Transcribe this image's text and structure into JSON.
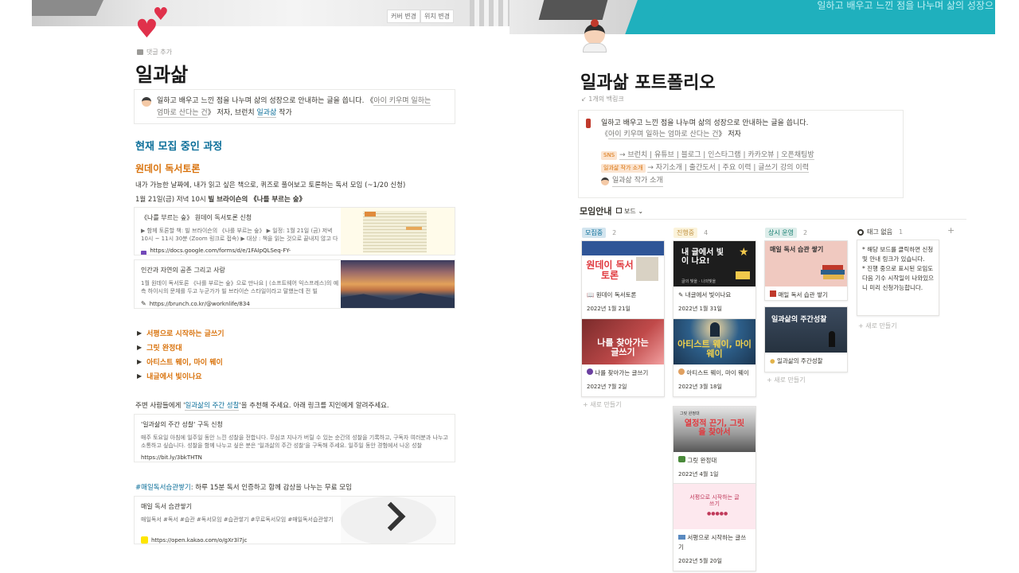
{
  "left": {
    "cover_buttons": [
      "커버 변경",
      "위치 변경"
    ],
    "add_comment": "댓글 추가",
    "title": "일과삶",
    "callout": {
      "line1": "일하고 배우고 느낀 점을 나누며 삶의 성장으로 안내하는 글을 씁니다. 《",
      "book_link": "아이 키우며 일하는",
      "line2_link": "엄마로 산다는 건",
      "line2_rest": "》 저자, 브런치 ",
      "brunch_link": "일과삶",
      "line2_end": " 작가"
    },
    "section_heading": "현재 모집 중인 과정",
    "oneday": {
      "heading": "원데이 독서토론",
      "desc": "내가 가능한 날짜에, 내가 읽고 싶은 책으로, 퀴즈로 풀어보고 토론하는 독서 모임 (~1/20 신청)",
      "date_line": "1월 21일(금) 저녁 10시 ",
      "date_bold": "빌 브라이슨의 《나를 부르는 숲》"
    },
    "bookmark1": {
      "title": "《나를 부르는 숲》 원데이 독서토론 신청",
      "desc": "▶ 함께 토론할 책: 빌 브라이슨의 《나를 부르는 숲》 ▶ 일정: 1월 21일 (금) 저녁 10시 ~ 11시 30분 (Zoom 링크로 접속) ▶ 대상 : 책을 읽는 것으로 끝내지 않고 다",
      "url": "https://docs.google.com/forms/d/e/1FAIpQLSeq-FY-38cwR4KwlHhDm43w..."
    },
    "bookmark2": {
      "title": "인간과 자연의 공존 그리고 사랑",
      "desc": "1월 원데이 독서토론 《나를 부르는 숲》으로 만나요 | (소프트웨어 익스프레스)의 예측 하이시의 문체를 두고 누군가가 빌 브라이슨 스타일이라고 말했는데 전 빌",
      "url": "https://brunch.co.kr/@worknlife/834"
    },
    "toggles": [
      "서평으로 시작하는 글쓰기",
      "그릿 완정대",
      "아티스트 웨이, 마이 웨이",
      "내글에서 빛이나요"
    ],
    "recommend": {
      "before": "주변 사람들에게 '",
      "link": "일과삶의 주간 성찰",
      "after": "'을 추천해 주세요. 아래 링크를 지인에게 알려주세요."
    },
    "bookmark3": {
      "title": "'일과삶의 주간 성찰' 구독 신청",
      "desc": "매주 토요일 아침에 일주일 동안 느낀 성찰을 전합니다. 무심코 지나가 버릴 수 있는 순간의 성찰을 기록하고, 구독자 여러분과 나누고 소통하고 싶습니다. 성찰을 함께 나누고 싶은 분은 '일과삶의 주간 성찰'을 구독해 주세요. 일주일 동안 경험에서 나온 성찰",
      "url": "https://bit.ly/3bkTHTN"
    },
    "reading": {
      "hashtag": "#매일독서습관쌓기",
      "text": ": 하루 15분 독서 인증하고 함께 감상을 나누는 무료 모임"
    },
    "bookmark4": {
      "title": "매일 독서 습관쌓기",
      "desc": "매일독서 #독서 #습관 #독서모임 #습관쌓기 #무료독서모임 #매일독서습관쌓기",
      "url": "https://open.kakao.com/o/gXr3l7jc"
    }
  },
  "right": {
    "cover_text": "일하고 배우고 느낀 점을 나누며 삶의 성장으",
    "title": "일과삶 포트폴리오",
    "backlinks": "1개의 백링크",
    "callout": {
      "line1": "일하고 배우고 느낀 점을 나누며 삶의 성장으로 안내하는 글을 씁니다.",
      "line2_open": "《",
      "line2_link": "아이 키우며 일하는 엄마로 산다는 건",
      "line2_close": "》 저자",
      "sns_tag": "SNS",
      "sns_links": "→ 브런치 | 유튜브 | 블로그 | 인스타그램 | 카카오뷰 | 오픈채팅방",
      "intro_tag": "일과삶 작가 소개",
      "intro_links": "→ 자기소개 | 출간도서 | 주요 이력 | 글쓰기 강의 이력",
      "author_link": "일과삶 작가 소개"
    },
    "section_title": "모임안내",
    "view_label": "보드",
    "columns": [
      {
        "label": "모집중",
        "count": "2",
        "bg": "#d3e5ef",
        "fg": "#0b6e99"
      },
      {
        "label": "진행중",
        "count": "4",
        "bg": "#fbf3db",
        "fg": "#dfab01"
      },
      {
        "label": "상시 운영",
        "count": "2",
        "bg": "#ddedea",
        "fg": "#0f7b6c"
      },
      {
        "label": "태그 없음",
        "count": "1",
        "bg": "transparent",
        "fg": "#37352f"
      }
    ],
    "cards": {
      "c1": {
        "thumb": "원데이 독서토론",
        "title": "원데이 독서토론",
        "date": "2022년 1월 21일"
      },
      "c2": {
        "thumb": "나를 찾아가는 글쓰기",
        "title": "나를 찾아가는 글쓰기",
        "date": "2022년 7월 2일"
      },
      "c3": {
        "thumb": "내 글에서 빛이 나요!",
        "thumb_sub": "글의 빛을 · 나의빛을",
        "title": "내글에서 빛이나요",
        "date": "2022년 1월 31일"
      },
      "c4": {
        "thumb": "아티스트 웨이, 마이 웨이",
        "title": "아티스트 웨이, 마이 웨이",
        "date": "2022년 3월 18일"
      },
      "c5": {
        "thumb": "열정적 끈기, 그릿을 찾아서",
        "thumb_top": "그릿 완정대",
        "title": "그릿 완정대",
        "date": "2022년 4월 1일"
      },
      "c6": {
        "thumb": "서평으로 시작하는 글쓰기",
        "title": "서평으로 시작하는 글쓰기",
        "date": "2022년 5월 20일"
      },
      "c7": {
        "thumb": "매일 독서 습관 쌓기",
        "title": "매일 독서 습관 쌓기"
      },
      "c8": {
        "thumb": "일과삶의 주간성찰",
        "title": "일과삶의 주간성찰"
      }
    },
    "new_label": "새로 만들기",
    "notag_note": "* 해당 보드를 클릭하면 신청 및 안내 링크가 있습니다.\n* 진행 중으로 표시된 모임도 다음 기수 시작일이 나와있으니 미리 신청가능합니다."
  }
}
